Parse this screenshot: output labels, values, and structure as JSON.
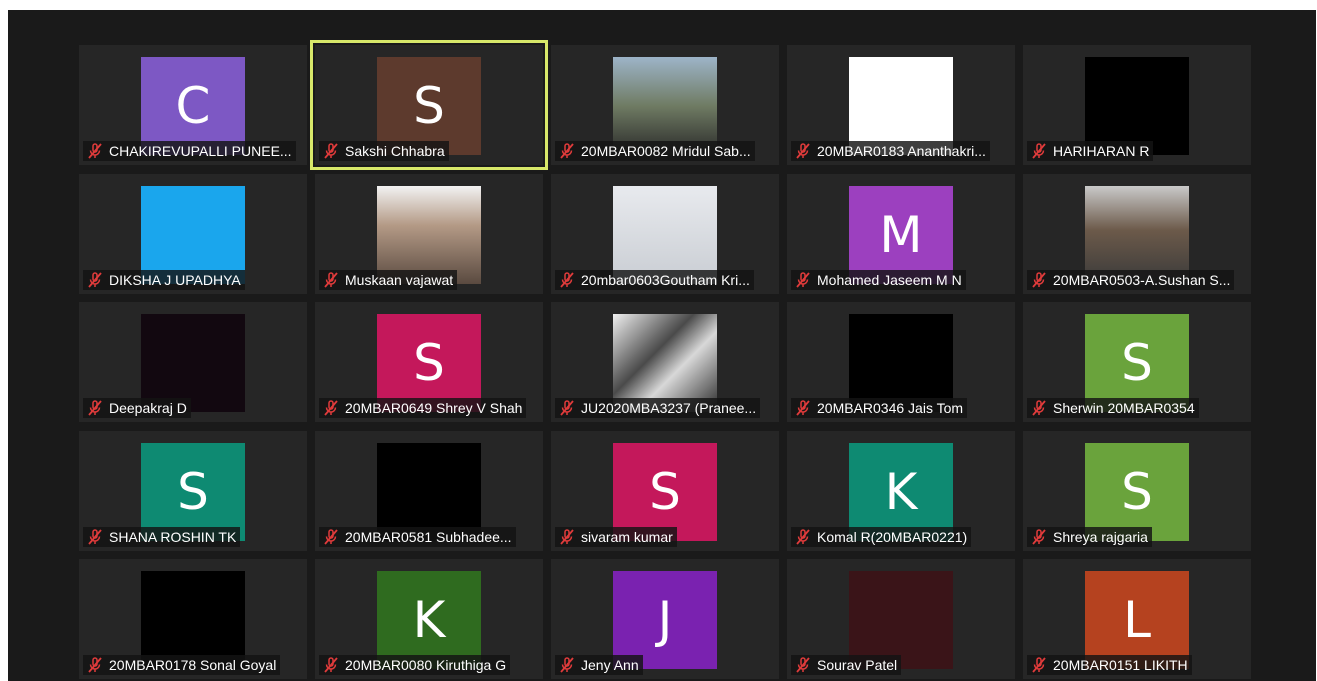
{
  "accent_color": "#d8e86a",
  "muted_icon": "microphone-muted-icon",
  "participants": [
    {
      "name": "CHAKIREVUPALLI PUNEE...",
      "initial": "C",
      "color": "#7d58c4",
      "muted": true,
      "active": false
    },
    {
      "name": "Sakshi Chhabra",
      "initial": "S",
      "color": "#5d3a2d",
      "muted": true,
      "active": true
    },
    {
      "name": "20MBAR0082 Mridul Sab...",
      "photo": true,
      "muted": true,
      "active": false
    },
    {
      "name": "20MBAR0183 Ananthakri...",
      "color": "#ffffff",
      "muted": true,
      "active": false
    },
    {
      "name": "HARIHARAN R",
      "color": "#000000",
      "muted": true,
      "active": false
    },
    {
      "name": "DIKSHA J UPADHYA",
      "color": "#1aa6ed",
      "muted": true,
      "active": false
    },
    {
      "name": "Muskaan vajawat",
      "photo": true,
      "muted": true,
      "active": false
    },
    {
      "name": "20mbar0603Goutham Kri...",
      "photo": true,
      "muted": true,
      "active": false
    },
    {
      "name": "Mohamed Jaseem M N",
      "initial": "M",
      "color": "#9c40bf",
      "muted": true,
      "active": false
    },
    {
      "name": "20MBAR0503-A.Sushan S...",
      "photo": true,
      "muted": true,
      "active": false
    },
    {
      "name": "Deepakraj D",
      "color": "#120810",
      "muted": true,
      "active": false
    },
    {
      "name": "20MBAR0649 Shrey V Shah",
      "initial": "S",
      "color": "#c4185b",
      "muted": true,
      "active": false
    },
    {
      "name": "JU2020MBA3237 (Pranee...",
      "photo": true,
      "muted": true,
      "active": false
    },
    {
      "name": "20MBAR0346 Jais Tom",
      "color": "#000000",
      "muted": true,
      "active": false
    },
    {
      "name": "Sherwin 20MBAR0354",
      "initial": "S",
      "color": "#6aa33c",
      "muted": true,
      "active": false
    },
    {
      "name": "SHANA ROSHIN TK",
      "initial": "S",
      "color": "#0e8a72",
      "muted": true,
      "active": false
    },
    {
      "name": "20MBAR0581   Subhadee...",
      "color": "#000000",
      "muted": true,
      "active": false
    },
    {
      "name": "sivaram kumar",
      "initial": "S",
      "color": "#c4185b",
      "muted": true,
      "active": false
    },
    {
      "name": "Komal R(20MBAR0221)",
      "initial": "K",
      "color": "#0e8a72",
      "muted": true,
      "active": false
    },
    {
      "name": "Shreya rajgaria",
      "initial": "S",
      "color": "#6aa33c",
      "muted": true,
      "active": false
    },
    {
      "name": "20MBAR0178 Sonal Goyal",
      "color": "#000000",
      "muted": true,
      "active": false
    },
    {
      "name": "20MBAR0080 Kiruthiga G",
      "initial": "K",
      "color": "#2f6b1f",
      "muted": true,
      "active": false
    },
    {
      "name": "Jeny Ann",
      "initial": "J",
      "color": "#7a22b0",
      "muted": true,
      "active": false
    },
    {
      "name": "Sourav Patel",
      "color": "#3a1418",
      "muted": true,
      "active": false
    },
    {
      "name": "20MBAR0151 LIKITH",
      "initial": "L",
      "color": "#b5421f",
      "muted": true,
      "active": false
    }
  ]
}
